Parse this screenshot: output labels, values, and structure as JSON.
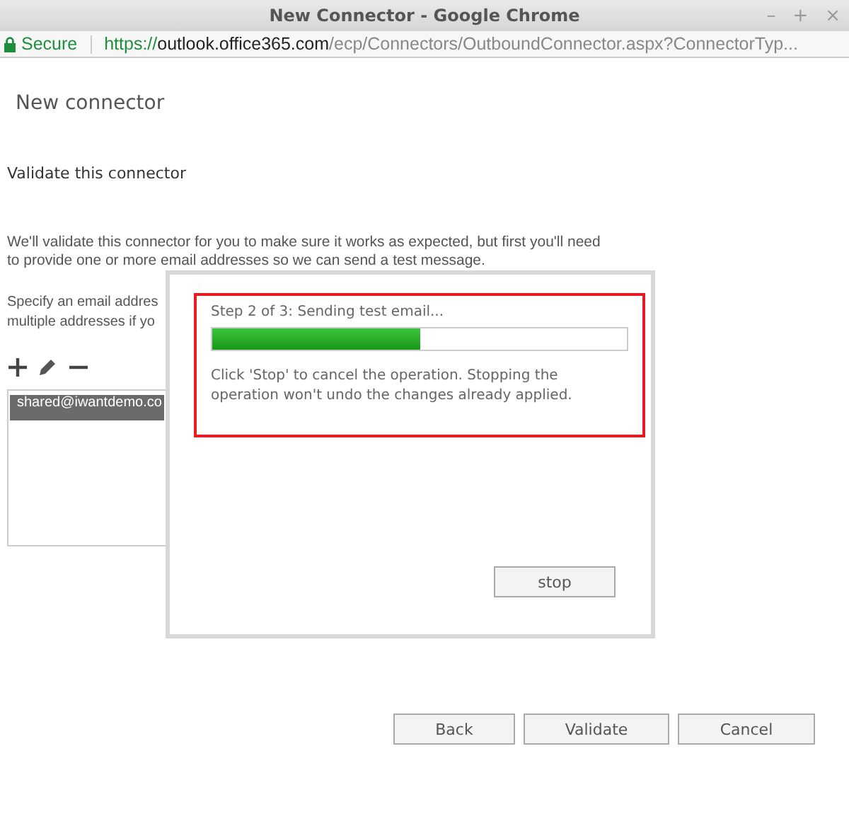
{
  "window": {
    "title": "New Connector - Google Chrome",
    "controls": [
      "–",
      "+",
      "×"
    ]
  },
  "address_bar": {
    "security": "Secure",
    "url_scheme": "https://",
    "url_host": "outlook.office365.com",
    "url_path": "/ecp/Connectors/OutboundConnector.aspx?ConnectorTyp..."
  },
  "page": {
    "title": "New connector",
    "heading": "Validate this connector",
    "description": [
      "We'll validate this connector for you to make sure it works as expected, but first you'll need",
      "to provide one or more email addresses so we can send a test message."
    ],
    "instructions": [
      "Specify an email addres",
      "multiple addresses if yo"
    ],
    "toolbar": [
      {
        "kind": "add"
      },
      {
        "kind": "edit"
      },
      {
        "kind": "remove"
      }
    ],
    "addresses": [
      {
        "text": "shared@iwantdemo.co",
        "selected": true
      }
    ]
  },
  "dialog": {
    "status": "Step 2 of 3: Sending test email...",
    "progress": {
      "level": 0.5
    },
    "message": "Click 'Stop' to cancel the operation. Stopping the operation won't undo the changes already applied.",
    "highlighted": true,
    "button": "stop"
  },
  "buttons": [
    "Back",
    "Validate",
    "Cancel"
  ]
}
